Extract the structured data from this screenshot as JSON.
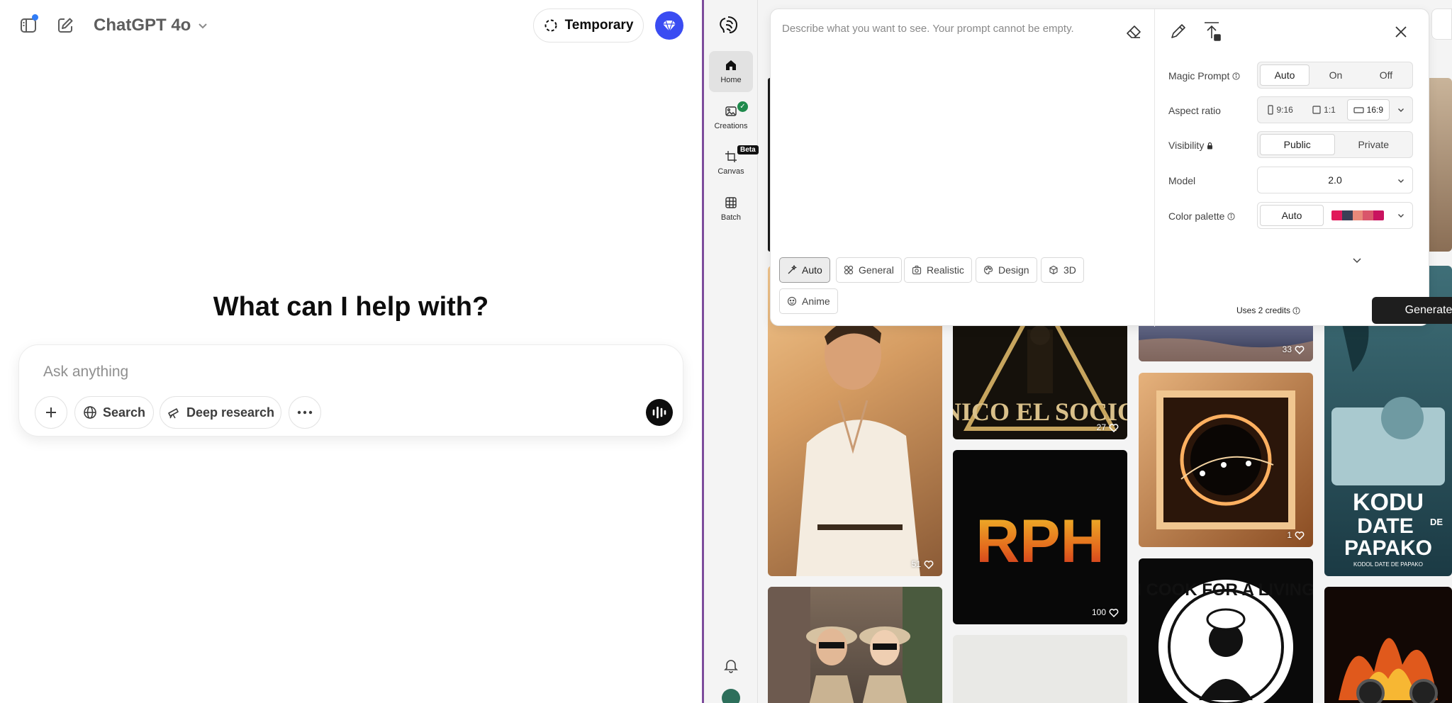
{
  "chatgpt": {
    "model_label": "ChatGPT 4o",
    "temporary_label": "Temporary",
    "heading": "What can I help with?",
    "composer": {
      "placeholder": "Ask anything",
      "search_label": "Search",
      "deep_research_label": "Deep research"
    }
  },
  "ideogram": {
    "nav": [
      {
        "label": "Home",
        "icon": "home-icon"
      },
      {
        "label": "Creations",
        "icon": "image-icon"
      },
      {
        "label": "Canvas",
        "icon": "canvas-icon",
        "badge": "Beta"
      },
      {
        "label": "Batch",
        "icon": "grid-icon"
      }
    ],
    "prompt_placeholder": "Describe what you want to see. Your prompt cannot be empty.",
    "styles": [
      "Auto",
      "General",
      "Realistic",
      "Design",
      "3D",
      "Anime"
    ],
    "selected_style": "Auto",
    "options": {
      "magic_prompt": {
        "label": "Magic Prompt",
        "choices": [
          "Auto",
          "On",
          "Off"
        ],
        "selected": "Auto"
      },
      "aspect_ratio": {
        "label": "Aspect ratio",
        "choices": [
          "9:16",
          "1:1",
          "16:9"
        ],
        "selected": "16:9"
      },
      "visibility": {
        "label": "Visibility",
        "choices": [
          "Public",
          "Private"
        ],
        "selected": "Public"
      },
      "model": {
        "label": "Model",
        "value": "2.0"
      },
      "color_palette": {
        "label": "Color palette",
        "value": "Auto",
        "colors": [
          "#e0195a",
          "#3b3f56",
          "#e8897a",
          "#d9566b",
          "#c9135f"
        ]
      }
    },
    "credits_label": "Uses 2 credits",
    "generate_label": "Generate",
    "gallery": {
      "likes": [
        "51",
        "27",
        "33",
        "100",
        "1"
      ],
      "poster_text": {
        "nico": "NICO EL SOCIO",
        "rph": "RPH",
        "cook": "I COOK FOR A LIVING",
        "kodu_line1": "KODU",
        "kodu_line2": "DATE",
        "kodu_de": "DE",
        "kodu_line3": "PAPAKO",
        "kodu_sub": "KODOL DATE DE PAPAKO"
      }
    },
    "colors": {
      "accent_dark": "#1e1e1e",
      "divider": "#7d4c9c",
      "chatgpt_plus": "#3a4cf2"
    }
  }
}
